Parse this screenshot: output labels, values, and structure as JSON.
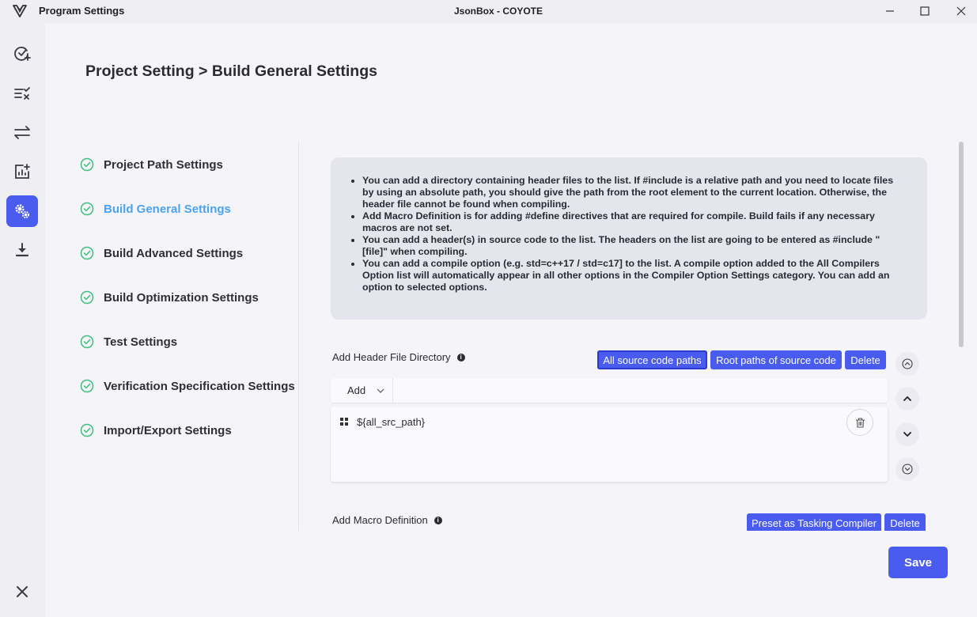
{
  "window": {
    "app_title": "Program Settings",
    "center_title": "JsonBox - COYOTE"
  },
  "sidebar": {
    "icons": [
      "check-circle-plus-icon",
      "list-check-icon",
      "transfer-arrows-icon",
      "chart-add-icon",
      "settings-gears-icon",
      "download-icon",
      "close-icon"
    ],
    "active": "settings-gears-icon"
  },
  "page": {
    "title": "Project Setting > Build General Settings"
  },
  "nav": {
    "items": [
      {
        "label": "Project Path Settings"
      },
      {
        "label": "Build General Settings"
      },
      {
        "label": "Build Advanced Settings"
      },
      {
        "label": "Build Optimization Settings"
      },
      {
        "label": "Test Settings"
      },
      {
        "label": "Verification Specification Settings"
      },
      {
        "label": "Import/Export Settings"
      }
    ],
    "active_index": 1
  },
  "info": {
    "bullets": [
      "You can add a directory containing header files to the list. If #include is a relative path and you need to locate files by using an absolute path, you should give the path from the root element to the current location. Otherwise, the header file cannot be found when compiling.",
      "Add Macro Definition is for adding #define directives that are required for compile. Build fails if any necessary macros are not set.",
      "You can add a header(s) in source code to the list. The headers on the list are going to be entered as #include \"[file]\" when compiling.",
      "You can add a compile option (e.g. std=c++17 / std=c17] to the list. A compile option added to the All Compilers Option list will automatically appear in all other options in the Compiler Option Settings category. You can add an option to selected options."
    ]
  },
  "header_dir": {
    "label": "Add Header File Directory",
    "btn_all_src": "All source code paths",
    "btn_root": "Root paths of source code",
    "btn_delete": "Delete",
    "add_label": "Add",
    "items": [
      {
        "value": "${all_src_path}"
      }
    ]
  },
  "macro": {
    "label": "Add Macro Definition",
    "btn_preset": "Preset as Tasking Compiler",
    "btn_delete": "Delete"
  },
  "footer": {
    "save": "Save"
  },
  "colors": {
    "accent": "#4a5cf0",
    "active_nav": "#4aa3f0",
    "check": "#3cc07a"
  }
}
